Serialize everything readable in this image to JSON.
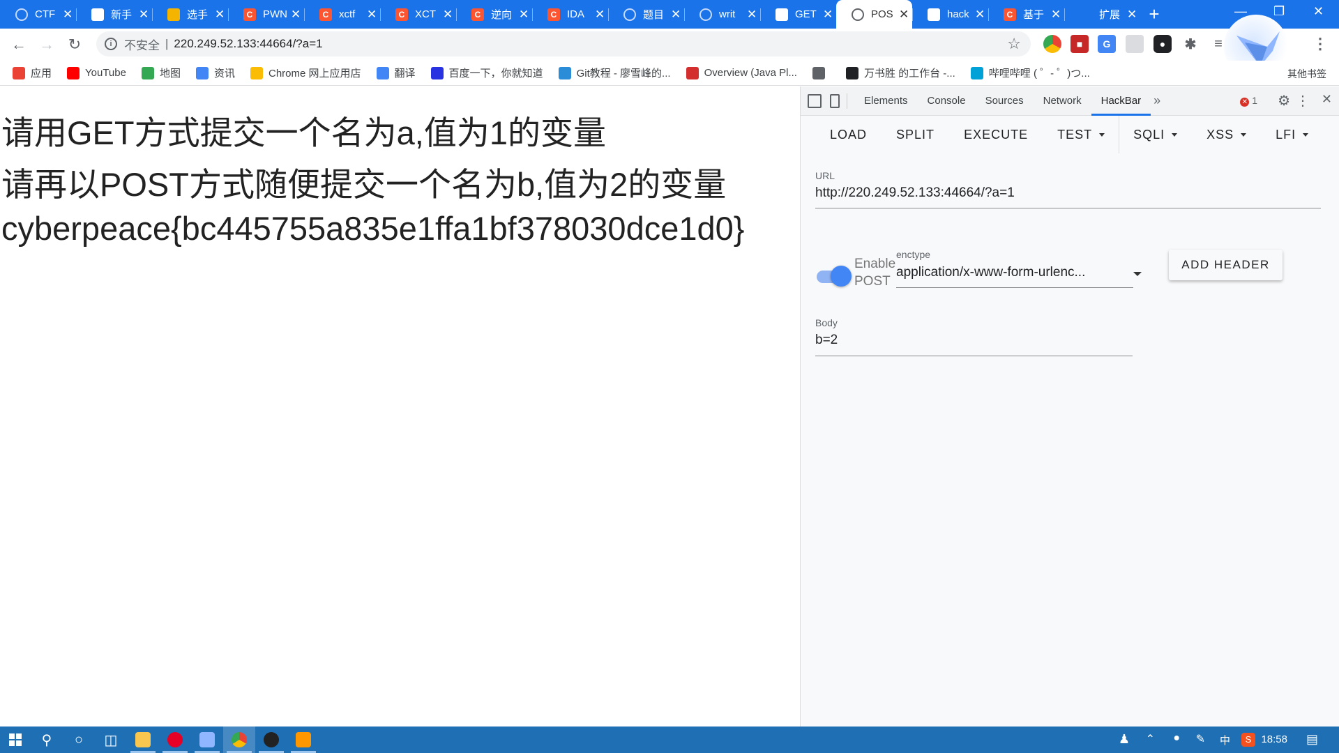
{
  "browser": {
    "tabs": [
      {
        "title": "CTF",
        "favicon": "globe-icon",
        "color": "#e8f0fe",
        "active": false
      },
      {
        "title": "新手",
        "favicon": "feather-icon",
        "color": "#ffffff",
        "active": false
      },
      {
        "title": "选手",
        "favicon": "sun-icon",
        "color": "#f4b400",
        "active": false
      },
      {
        "title": "PWN",
        "favicon": "csdn-icon",
        "color": "#fc5531",
        "active": false
      },
      {
        "title": "xctf",
        "favicon": "csdn-icon",
        "color": "#fc5531",
        "active": false
      },
      {
        "title": "XCT",
        "favicon": "csdn-icon",
        "color": "#fc5531",
        "active": false
      },
      {
        "title": "逆向",
        "favicon": "csdn-icon",
        "color": "#fc5531",
        "active": false
      },
      {
        "title": "IDA",
        "favicon": "csdn-icon",
        "color": "#fc5531",
        "active": false
      },
      {
        "title": "题目",
        "favicon": "globe-icon",
        "color": "#e8f0fe",
        "active": false
      },
      {
        "title": "writ",
        "favicon": "globe-icon",
        "color": "#e8f0fe",
        "active": false
      },
      {
        "title": "GET",
        "favicon": "paw-icon",
        "color": "#ffffff",
        "active": false
      },
      {
        "title": "POS",
        "favicon": "globe-icon",
        "color": "#5f6368",
        "active": true
      },
      {
        "title": "hack",
        "favicon": "paw-icon",
        "color": "#ffffff",
        "active": false
      },
      {
        "title": "基于",
        "favicon": "csdn-icon",
        "color": "#fc5531",
        "active": false
      },
      {
        "title": "扩展",
        "favicon": "puzzle-icon",
        "color": "#1a73e8",
        "active": false
      }
    ],
    "address": {
      "insecure_label": "不安全",
      "url": "220.249.52.133:44664/?a=1"
    },
    "bookmarks": [
      {
        "label": "应用",
        "color": "#ea4335"
      },
      {
        "label": "YouTube",
        "color": "#ff0000"
      },
      {
        "label": "地图",
        "color": "#34a853"
      },
      {
        "label": "资讯",
        "color": "#4285f4"
      },
      {
        "label": "Chrome 网上应用店",
        "color": "#fbbc05"
      },
      {
        "label": "翻译",
        "color": "#4285f4"
      },
      {
        "label": "百度一下，你就知道",
        "color": "#2932e1"
      },
      {
        "label": "Git教程 - 廖雪峰的...",
        "color": "#2b8dd8"
      },
      {
        "label": "Overview (Java Pl...",
        "color": "#d32f2f"
      },
      {
        "label": "",
        "color": "#5f6368"
      },
      {
        "label": "万书胜 的工作台 -...",
        "color": "#202124"
      },
      {
        "label": "哔哩哔哩 ( ゜- ゜)つ...",
        "color": "#00a1d6"
      }
    ],
    "other_bookmarks": "其他书签"
  },
  "page": {
    "lines": [
      "请用GET方式提交一个名为a,值为1的变量",
      "请再以POST方式随便提交一个名为b,值为2的变量",
      "cyberpeace{bc445755a835e1ffa1bf378030dce1d0}"
    ]
  },
  "devtools": {
    "tabs": [
      "Elements",
      "Console",
      "Sources",
      "Network",
      "HackBar"
    ],
    "active_tab": "HackBar",
    "error_count": "1",
    "hackbar": {
      "menu": [
        "LOAD",
        "SPLIT",
        "EXECUTE",
        "TEST",
        "SQLI",
        "XSS",
        "LFI"
      ],
      "url_label": "URL",
      "url_value": "http://220.249.52.133:44664/?a=1",
      "enable_post_line1": "Enable",
      "enable_post_line2": "POST",
      "enable_post_on": true,
      "enctype_label": "enctype",
      "enctype_value": "application/x-www-form-urlenc...",
      "add_header": "ADD HEADER",
      "body_label": "Body",
      "body_value": "b=2"
    }
  },
  "taskbar": {
    "clock": "18:58",
    "ime": "中"
  }
}
